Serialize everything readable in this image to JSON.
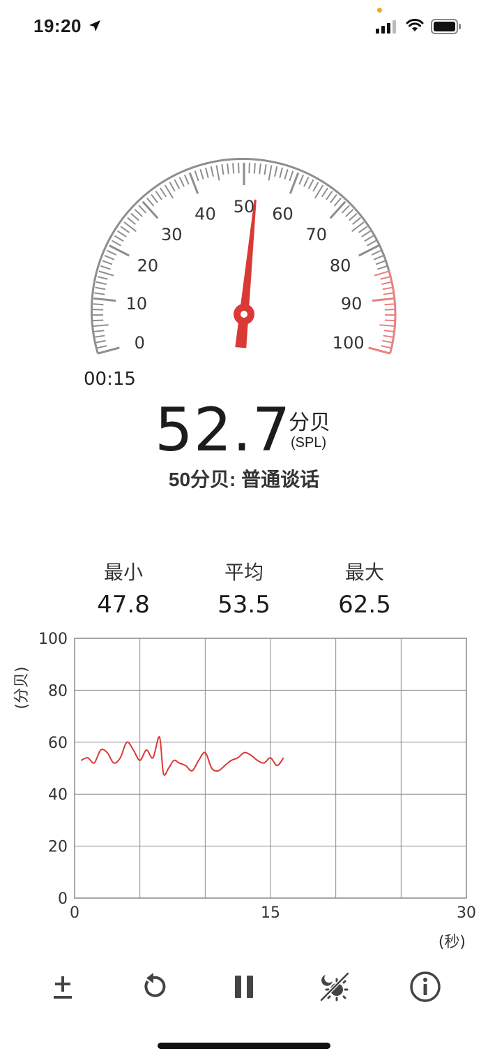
{
  "status_bar": {
    "time": "19:20",
    "icons": [
      "location-arrow-icon",
      "signal-icon",
      "wifi-icon",
      "battery-icon"
    ],
    "indicator_dot_color": "#f5a623"
  },
  "gauge": {
    "scale_labels": [
      "0",
      "10",
      "20",
      "30",
      "40",
      "50",
      "60",
      "70",
      "80",
      "90",
      "100"
    ],
    "min": 0,
    "max": 100,
    "needle_value": 52.7,
    "danger_from": 85,
    "needle_color": "#d93a35",
    "danger_color": "#e98080"
  },
  "timer": "00:15",
  "reading": {
    "value": "52.7",
    "unit": "分贝",
    "unit_sub": "(SPL)",
    "description": "50分贝: 普通谈话"
  },
  "stats": [
    {
      "label": "最小",
      "value": "47.8"
    },
    {
      "label": "平均",
      "value": "53.5"
    },
    {
      "label": "最大",
      "value": "62.5"
    }
  ],
  "chart_data": {
    "type": "line",
    "ylabel": "(分贝)",
    "xlabel": "(秒)",
    "xlim": [
      0,
      30
    ],
    "ylim": [
      0,
      100
    ],
    "x_ticks": [
      "0",
      "15",
      "30"
    ],
    "y_ticks": [
      "0",
      "20",
      "40",
      "60",
      "80",
      "100"
    ],
    "grid": true,
    "series": [
      {
        "color": "#d93a35",
        "x": [
          0.5,
          1.0,
          1.5,
          2.0,
          2.5,
          3.0,
          3.5,
          4.0,
          4.5,
          5.0,
          5.5,
          6.0,
          6.5,
          6.8,
          7.2,
          7.6,
          8.0,
          8.5,
          9.0,
          9.5,
          10.0,
          10.5,
          11.0,
          11.5,
          12.0,
          12.5,
          13.0,
          13.5,
          14.0,
          14.5,
          15.0,
          15.5,
          16.0
        ],
        "y": [
          53,
          54,
          52,
          57,
          56,
          52,
          54,
          60,
          57,
          53,
          57,
          54,
          62,
          48,
          50,
          53,
          52,
          51,
          49,
          53,
          56,
          50,
          49,
          51,
          53,
          54,
          56,
          55,
          53,
          52,
          54,
          51,
          54
        ]
      }
    ]
  },
  "toolbar": {
    "icons": [
      "plus-minus-icon",
      "reset-icon",
      "pause-icon",
      "theme-toggle-icon",
      "info-icon"
    ]
  }
}
